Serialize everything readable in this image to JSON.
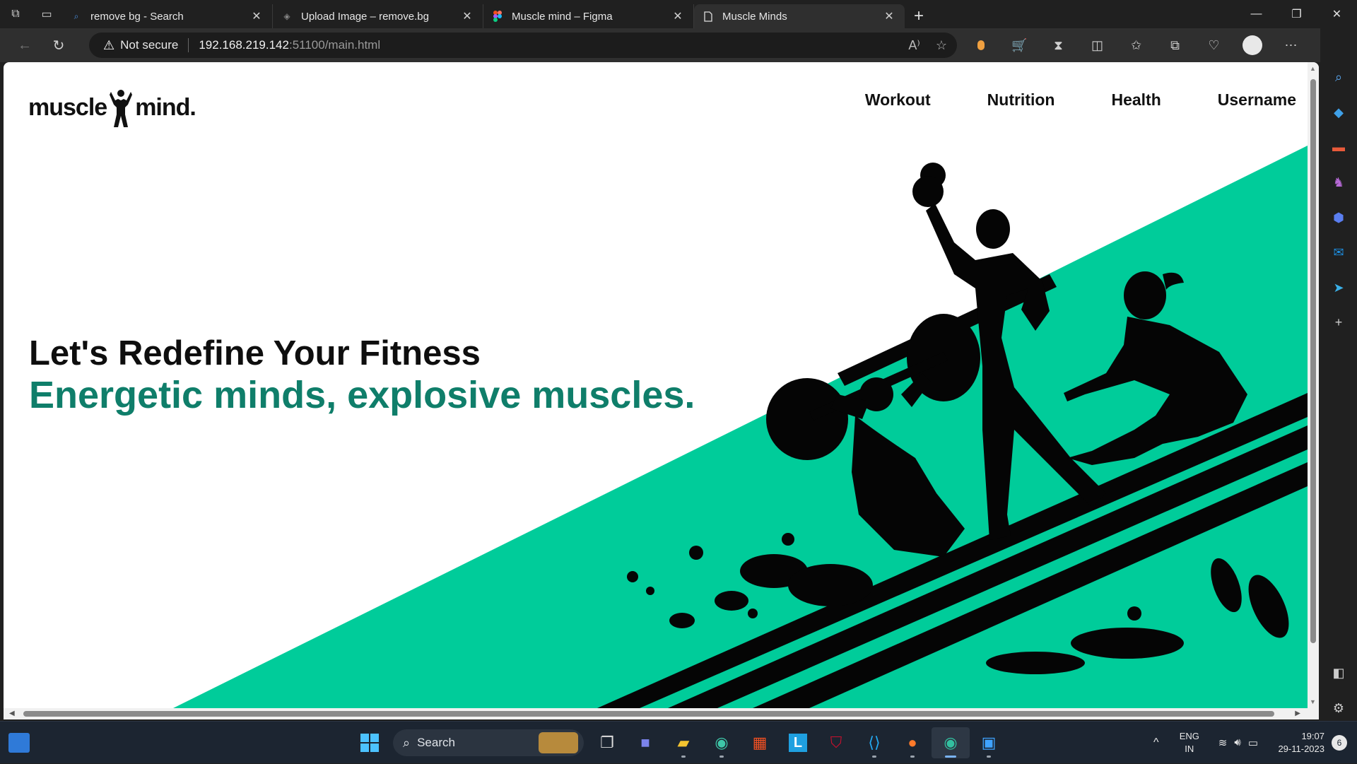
{
  "browser": {
    "tabs": [
      {
        "title": "remove bg - Search",
        "icon": "search-icon"
      },
      {
        "title": "Upload Image – remove.bg",
        "icon": "layers-icon"
      },
      {
        "title": "Muscle mind – Figma",
        "icon": "figma-icon"
      },
      {
        "title": "Muscle Minds",
        "icon": "page-icon",
        "active": true
      }
    ],
    "security_label": "Not secure",
    "url_host": "192.168.219.142",
    "url_path": ":51100/main.html"
  },
  "site": {
    "logo_left": "muscle",
    "logo_right": "mind.",
    "nav": [
      "Workout",
      "Nutrition",
      "Health",
      "Username"
    ],
    "headline": "Let's Redefine Your Fitness",
    "tagline": "Energetic minds, explosive muscles.",
    "accent_color": "#00cc9a",
    "tagline_color": "#0f7e6a"
  },
  "taskbar": {
    "search_label": "Search",
    "lang_top": "ENG",
    "lang_bottom": "IN",
    "time": "19:07",
    "date": "29-11-2023",
    "notification_count": "6"
  }
}
